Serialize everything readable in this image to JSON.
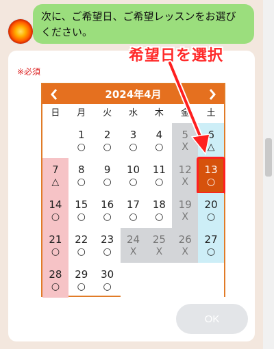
{
  "chat": {
    "message": "次に、ご希望日、ご希望レッスンをお選びください。"
  },
  "form": {
    "required_label": "※必須",
    "annotation": "希望日を選択",
    "ok_label": "OK"
  },
  "calendar": {
    "month_label": "2024年4月",
    "weekdays": [
      "日",
      "月",
      "火",
      "水",
      "木",
      "金",
      "土"
    ],
    "weeks": [
      [
        {
          "day": "",
          "status": "",
          "type": "empty"
        },
        {
          "day": "1",
          "status": "○",
          "type": "normal"
        },
        {
          "day": "2",
          "status": "○",
          "type": "normal"
        },
        {
          "day": "3",
          "status": "○",
          "type": "normal"
        },
        {
          "day": "4",
          "status": "○",
          "type": "normal"
        },
        {
          "day": "5",
          "status": "X",
          "type": "disabled"
        },
        {
          "day": "6",
          "status": "△",
          "type": "sat"
        }
      ],
      [
        {
          "day": "7",
          "status": "△",
          "type": "sun"
        },
        {
          "day": "8",
          "status": "○",
          "type": "normal"
        },
        {
          "day": "9",
          "status": "○",
          "type": "normal"
        },
        {
          "day": "10",
          "status": "○",
          "type": "normal"
        },
        {
          "day": "11",
          "status": "○",
          "type": "normal"
        },
        {
          "day": "12",
          "status": "X",
          "type": "disabled"
        },
        {
          "day": "13",
          "status": "○",
          "type": "selected"
        }
      ],
      [
        {
          "day": "14",
          "status": "○",
          "type": "sun"
        },
        {
          "day": "15",
          "status": "○",
          "type": "normal"
        },
        {
          "day": "16",
          "status": "○",
          "type": "normal"
        },
        {
          "day": "17",
          "status": "○",
          "type": "normal"
        },
        {
          "day": "18",
          "status": "○",
          "type": "normal"
        },
        {
          "day": "19",
          "status": "X",
          "type": "disabled"
        },
        {
          "day": "20",
          "status": "○",
          "type": "sat"
        }
      ],
      [
        {
          "day": "21",
          "status": "○",
          "type": "sun"
        },
        {
          "day": "22",
          "status": "○",
          "type": "normal"
        },
        {
          "day": "23",
          "status": "○",
          "type": "normal"
        },
        {
          "day": "24",
          "status": "X",
          "type": "disabled"
        },
        {
          "day": "25",
          "status": "X",
          "type": "disabled"
        },
        {
          "day": "26",
          "status": "X",
          "type": "disabled"
        },
        {
          "day": "27",
          "status": "○",
          "type": "sat"
        }
      ],
      [
        {
          "day": "28",
          "status": "○",
          "type": "sun"
        },
        {
          "day": "29",
          "status": "○",
          "type": "normal"
        },
        {
          "day": "30",
          "status": "○",
          "type": "normal"
        },
        {
          "day": "",
          "status": "",
          "type": "empty"
        },
        {
          "day": "",
          "status": "",
          "type": "empty"
        },
        {
          "day": "",
          "status": "",
          "type": "empty"
        },
        {
          "day": "",
          "status": "",
          "type": "empty"
        }
      ]
    ]
  },
  "icons": {
    "avatar": "sun-avatar-icon",
    "prev": "chevron-left-icon",
    "next": "chevron-right-icon",
    "arrow": "arrow-annotation-icon"
  },
  "colors": {
    "background": "#f3e7de",
    "bubble": "#9bde7d",
    "calendar_header": "#e5701f",
    "sunday": "#f6c3c6",
    "saturday": "#cdeef7",
    "disabled": "#d3d5d8",
    "selected": "#d6520c",
    "annotation": "#ff2a2a"
  }
}
